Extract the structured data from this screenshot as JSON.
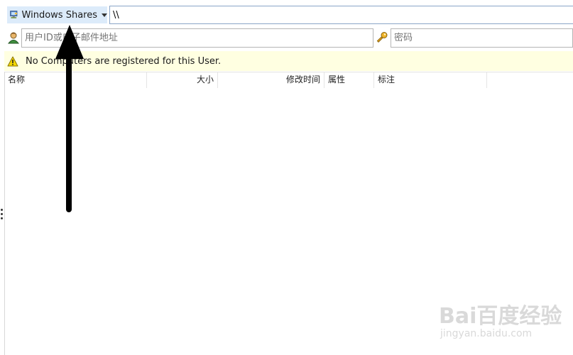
{
  "path_bar": {
    "protocol_label": "Windows Shares",
    "path_value": "\\\\"
  },
  "credentials": {
    "user_placeholder": "用户ID或电子邮件地址",
    "password_placeholder": "密码"
  },
  "notice": {
    "message": "No Computers are registered for this User."
  },
  "file_list": {
    "columns": [
      "名称",
      "大小",
      "修改时间",
      "属性",
      "标注"
    ],
    "rows": []
  },
  "watermark": {
    "logo": "Bai百度经验",
    "url": "jingyan.baidu.com"
  },
  "colors": {
    "protocol_button_bg": "#dcebfa",
    "notice_bg": "#ffffe1",
    "path_border": "#8aa6c8"
  },
  "icons": {
    "protocol": "network-computer-icon",
    "user": "user-icon",
    "password": "key-icon",
    "notice": "warning-icon"
  }
}
